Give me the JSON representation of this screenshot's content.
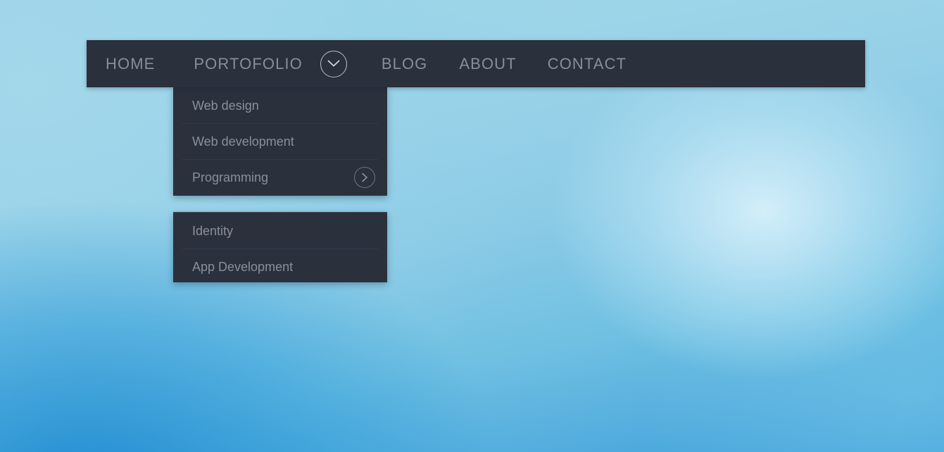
{
  "navbar": {
    "items": [
      {
        "id": "home",
        "label": "HOME"
      },
      {
        "id": "portfolio",
        "label": "PORTOFOLIO"
      },
      {
        "id": "blog",
        "label": "BLOG"
      },
      {
        "id": "about",
        "label": "ABOUT"
      },
      {
        "id": "contact",
        "label": "CONTACT"
      }
    ],
    "toggle_icon": "chevron-down-icon",
    "background_color": "#2b303d",
    "text_color": "#888e99"
  },
  "dropdown": {
    "items": [
      {
        "id": "web-design",
        "label": "Web design",
        "has_submenu": false
      },
      {
        "id": "web-development",
        "label": "Web development",
        "has_submenu": false
      },
      {
        "id": "programming",
        "label": "Programming",
        "has_submenu": true,
        "submenu_icon": "chevron-right-icon"
      }
    ],
    "background_color": "#2b303d",
    "text_color": "#8a8f9a"
  },
  "submenu": {
    "items": [
      {
        "id": "identity",
        "label": "Identity"
      },
      {
        "id": "app-development",
        "label": "App Development"
      }
    ],
    "background_color": "#2b303d",
    "text_color": "#8a8f9a"
  },
  "page": {
    "background_colors": {
      "top_left": "#a2d7e9",
      "highlight": "#d7f0fa",
      "bottom_left": "#2f97d7"
    }
  }
}
